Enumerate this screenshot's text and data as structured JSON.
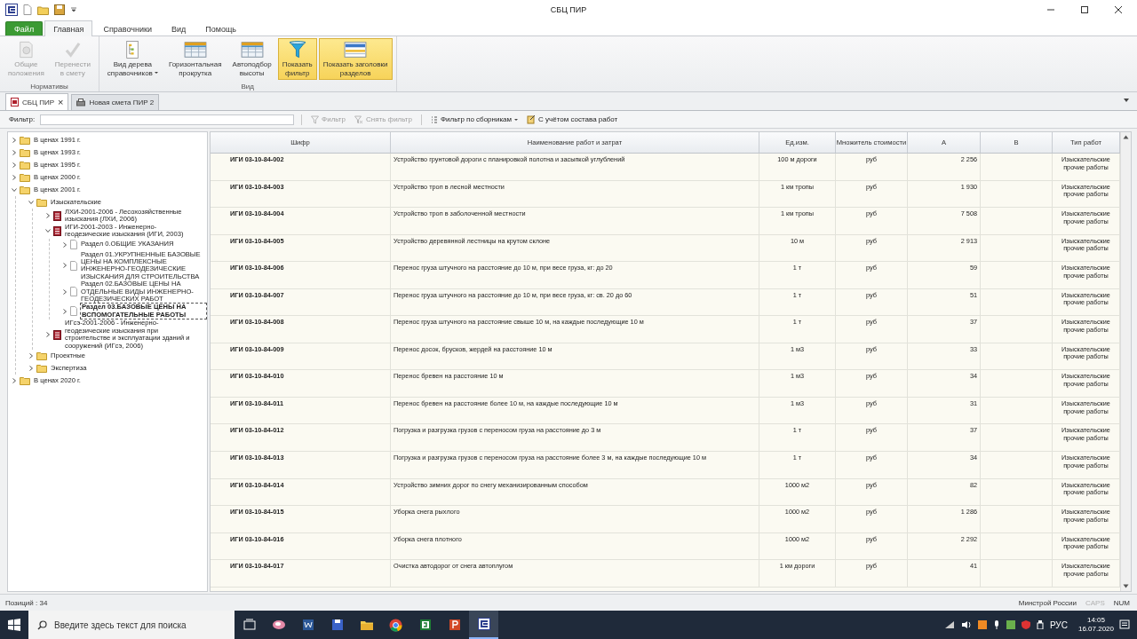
{
  "window": {
    "title": "СБЦ ПИР"
  },
  "ribbon": {
    "tabs": [
      {
        "label": "Файл",
        "kind": "file",
        "selected": false
      },
      {
        "label": "Главная",
        "kind": "tab",
        "selected": true
      },
      {
        "label": "Справочники",
        "kind": "tab",
        "selected": false
      },
      {
        "label": "Вид",
        "kind": "tab",
        "selected": false
      },
      {
        "label": "Помощь",
        "kind": "tab",
        "selected": false
      }
    ],
    "groups": [
      {
        "label": "Нормативы",
        "buttons": [
          {
            "label": "Общие\nположения",
            "kind": "shield",
            "disabled": true,
            "on": false,
            "dropdown": false
          },
          {
            "label": "Перенести\nв смету",
            "kind": "check",
            "disabled": true,
            "on": false,
            "dropdown": false
          }
        ]
      },
      {
        "label": "Вид",
        "buttons": [
          {
            "label": "Вид дерева\nсправочников",
            "kind": "tree",
            "disabled": false,
            "on": false,
            "dropdown": true
          },
          {
            "label": "Горизонтальная\nпрокрутка",
            "kind": "grid",
            "disabled": false,
            "on": false,
            "dropdown": false
          },
          {
            "label": "Автоподбор\nвысоты",
            "kind": "grid",
            "disabled": false,
            "on": false,
            "dropdown": false
          },
          {
            "label": "Показать\nфильтр",
            "kind": "funnel",
            "disabled": false,
            "on": true,
            "dropdown": false
          },
          {
            "label": "Показать заголовки\nразделов",
            "kind": "headers",
            "disabled": false,
            "on": true,
            "dropdown": false
          }
        ]
      }
    ]
  },
  "doc_tabs": [
    {
      "label": "СБЦ ПИР",
      "selected": true,
      "close": "×"
    },
    {
      "label": "Новая смета ПИР 2",
      "selected": false
    }
  ],
  "filter_bar": {
    "label": "Фильтр:",
    "buttons": [
      {
        "label": "Фильтр",
        "kind": "funnel",
        "disabled": true,
        "dropdown": false
      },
      {
        "label": "Снять фильтр",
        "kind": "clear",
        "disabled": true,
        "dropdown": false
      },
      {
        "label": "Фильтр по сборникам",
        "kind": "list",
        "disabled": false,
        "dropdown": true
      },
      {
        "label": "С учётом состава работ",
        "kind": "compose",
        "disabled": false,
        "dropdown": false
      }
    ]
  },
  "tree": [
    {
      "label": "В ценах 1991 г.",
      "kind": "folder",
      "expanded": false,
      "selected": false
    },
    {
      "label": "В ценах 1993 г.",
      "kind": "folder",
      "expanded": false,
      "selected": false
    },
    {
      "label": "В ценах 1995 г.",
      "kind": "folder",
      "expanded": false,
      "selected": false
    },
    {
      "label": "В ценах 2000 г.",
      "kind": "folder",
      "expanded": false,
      "selected": false
    },
    {
      "label": "В ценах 2001 г.",
      "kind": "folder",
      "expanded": true,
      "selected": false,
      "children": [
        {
          "label": "Изыскательские",
          "kind": "folder",
          "expanded": true,
          "selected": false,
          "children": [
            {
              "label": "ЛХИ-2001-2006 - Лесохозяйственные изыскания (ЛХИ, 2006)",
              "kind": "book",
              "expanded": false,
              "selected": false
            },
            {
              "label": "ИГИ-2001-2003 - Инженерно-геодезические изыскания (ИГИ, 2003)",
              "kind": "book",
              "expanded": true,
              "selected": false,
              "children": [
                {
                  "label": "Раздел 0.ОБЩИЕ УКАЗАНИЯ",
                  "kind": "page",
                  "expanded": false,
                  "selected": false
                },
                {
                  "label": "Раздел 01.УКРУПНЕННЫЕ БАЗОВЫЕ ЦЕНЫ НА КОМПЛЕКСНЫЕ ИНЖЕНЕРНО-ГЕОДЕЗИЧЕСКИЕ ИЗЫСКАНИЯ ДЛЯ СТРОИТЕЛЬСТВА",
                  "kind": "page",
                  "expanded": false,
                  "selected": false
                },
                {
                  "label": "Раздел 02.БАЗОВЫЕ ЦЕНЫ НА ОТДЕЛЬНЫЕ ВИДЫ ИНЖЕНЕРНО-ГЕОДЕЗИЧЕСКИХ РАБОТ",
                  "kind": "page",
                  "expanded": false,
                  "selected": false
                },
                {
                  "label": "Раздел 03.БАЗОВЫЕ ЦЕНЫ НА ВСПОМОГАТЕЛЬНЫЕ РАБОТЫ",
                  "kind": "page",
                  "expanded": false,
                  "selected": true
                }
              ]
            },
            {
              "label": "ИГсэ-2001-2006 - Инженерно-геодезические изыскания при строительстве и эксплуатации зданий и сооружений (ИГсэ, 2006)",
              "kind": "book",
              "expanded": false,
              "selected": false
            }
          ]
        },
        {
          "label": "Проектные",
          "kind": "folder",
          "expanded": false,
          "selected": false
        },
        {
          "label": "Экспертиза",
          "kind": "folder",
          "expanded": false,
          "selected": false
        }
      ]
    },
    {
      "label": "В ценах 2020 г.",
      "kind": "folder",
      "expanded": false,
      "selected": false
    }
  ],
  "table": {
    "columns": [
      "Шифр",
      "Наименование работ и затрат",
      "Ед.изм.",
      "Множитель стоимости",
      "A",
      "B",
      "Тип работ"
    ],
    "rows": [
      {
        "code": "ИГИ 03-10-84-002",
        "name": "Устройство грунтовой дороги с планировкой полотна и засыпкой углублений",
        "unit": "100 м дороги",
        "multiplier": "руб",
        "a": "2 256",
        "type": "Изыскательские прочие работы"
      },
      {
        "code": "ИГИ 03-10-84-003",
        "name": "Устройство троп в лесной местности",
        "unit": "1 км тропы",
        "multiplier": "руб",
        "a": "1 930",
        "type": "Изыскательские прочие работы"
      },
      {
        "code": "ИГИ 03-10-84-004",
        "name": "Устройство троп в заболоченной местности",
        "unit": "1 км тропы",
        "multiplier": "руб",
        "a": "7 508",
        "type": "Изыскательские прочие работы"
      },
      {
        "code": "ИГИ 03-10-84-005",
        "name": "Устройство деревянной лестницы на крутом склоне",
        "unit": "10 м",
        "multiplier": "руб",
        "a": "2 913",
        "type": "Изыскательские прочие работы"
      },
      {
        "code": "ИГИ 03-10-84-006",
        "name": "Перенос груза штучного на расстояние до 10 м, при весе груза, кг: до 20",
        "unit": "1 т",
        "multiplier": "руб",
        "a": "59",
        "type": "Изыскательские прочие работы"
      },
      {
        "code": "ИГИ 03-10-84-007",
        "name": "Перенос груза штучного на расстояние до 10 м, при весе груза, кг: св. 20 до 60",
        "unit": "1 т",
        "multiplier": "руб",
        "a": "51",
        "type": "Изыскательские прочие работы"
      },
      {
        "code": "ИГИ 03-10-84-008",
        "name": "Перенос груза штучного на расстояние свыше 10 м, на каждые последующие 10 м",
        "unit": "1 т",
        "multiplier": "руб",
        "a": "37",
        "type": "Изыскательские прочие работы"
      },
      {
        "code": "ИГИ 03-10-84-009",
        "name": "Перенос досок, брусков, жердей на расстояние 10 м",
        "unit": "1 м3",
        "multiplier": "руб",
        "a": "33",
        "type": "Изыскательские прочие работы"
      },
      {
        "code": "ИГИ 03-10-84-010",
        "name": "Перенос бревен на расстояние 10 м",
        "unit": "1 м3",
        "multiplier": "руб",
        "a": "34",
        "type": "Изыскательские прочие работы"
      },
      {
        "code": "ИГИ 03-10-84-011",
        "name": "Перенос бревен на расстояние более 10 м, на каждые последующие 10 м",
        "unit": "1 м3",
        "multiplier": "руб",
        "a": "31",
        "type": "Изыскательские прочие работы"
      },
      {
        "code": "ИГИ 03-10-84-012",
        "name": "Погрузка и разгрузка грузов с переносом груза на расстояние до 3 м",
        "unit": "1 т",
        "multiplier": "руб",
        "a": "37",
        "type": "Изыскательские прочие работы"
      },
      {
        "code": "ИГИ 03-10-84-013",
        "name": "Погрузка и разгрузка грузов с переносом груза на расстояние более 3 м, на каждые последующие 10 м",
        "unit": "1 т",
        "multiplier": "руб",
        "a": "34",
        "type": "Изыскательские прочие работы"
      },
      {
        "code": "ИГИ 03-10-84-014",
        "name": "Устройство зимних дорог по снегу механизированным способом",
        "unit": "1000 м2",
        "multiplier": "руб",
        "a": "82",
        "type": "Изыскательские прочие работы"
      },
      {
        "code": "ИГИ 03-10-84-015",
        "name": "Уборка снега рыхлого",
        "unit": "1000 м2",
        "multiplier": "руб",
        "a": "1 286",
        "type": "Изыскательские прочие работы"
      },
      {
        "code": "ИГИ 03-10-84-016",
        "name": "Уборка снега плотного",
        "unit": "1000 м2",
        "multiplier": "руб",
        "a": "2 292",
        "type": "Изыскательские прочие работы"
      },
      {
        "code": "ИГИ 03-10-84-017",
        "name": "Очистка автодорог от снега автоплугом",
        "unit": "1 км дороги",
        "multiplier": "руб",
        "a": "41",
        "type": "Изыскательские прочие работы"
      }
    ]
  },
  "status_bar": {
    "count": "Позиций : 34",
    "organization": "Минстрой России",
    "indicators": [
      {
        "label": "CAPS",
        "on": false
      },
      {
        "label": "NUM",
        "on": true
      }
    ]
  },
  "taskbar": {
    "search_placeholder": "Введите здесь текст для поиска",
    "apps": [
      {
        "kind": "taskview",
        "active": false
      },
      {
        "kind": "pink",
        "active": false
      },
      {
        "kind": "word",
        "active": false
      },
      {
        "kind": "save",
        "active": false
      },
      {
        "kind": "folder",
        "active": false
      },
      {
        "kind": "chrome",
        "active": false
      },
      {
        "kind": "green",
        "active": false
      },
      {
        "kind": "ppt",
        "active": false
      },
      {
        "kind": "sbc",
        "active": true
      }
    ],
    "language": "РУС",
    "time": "14:05",
    "date": "16.07.2020"
  }
}
